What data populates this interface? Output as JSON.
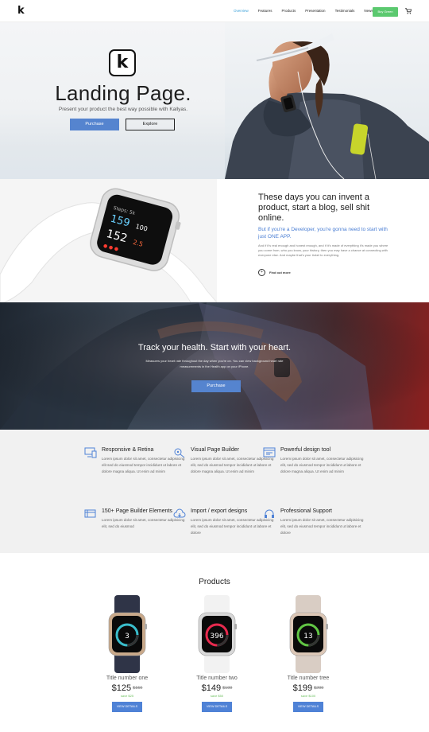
{
  "nav": {
    "logo": "k",
    "links": [
      "Overview",
      "Features",
      "Products",
      "Presentation",
      "Testimonials",
      "News"
    ],
    "cta": "Buy Green"
  },
  "hero": {
    "logo_letter": "k",
    "title": "Landing Page.",
    "subtitle": "Present your product the best way possible with Kallyas.",
    "btn_primary": "Purchase",
    "btn_secondary": "Explore"
  },
  "feature": {
    "heading": "These days you can invent a product, start a blog, sell shit online.",
    "lead": "But if you're a Developer, you're gonna need to start with just ONE APP.",
    "body": "And if it's real enough and honest enough, and if it's made of everything it's made you where you come from, who you know, your history, then you may have a chance at connecting with everyone else. And maybe that's your ticket to everything.",
    "link": "Find out more"
  },
  "health": {
    "title": "Track your health. Start with your heart.",
    "text": "Measures your heart rate throughout the day when you're on. You can view background heart rate measurements in the Health app on your iPhone.",
    "button": "Purchase"
  },
  "features_grid": [
    {
      "title": "Responsive & Retina",
      "text": "Lorem ipsum dolor sit amet, consectetur adipisicing elit sed do eiusmod tempor incididunt ut labore et dolore magna aliqua. Ut enim ad minim",
      "icon": "devices-icon"
    },
    {
      "title": "Visual Page Builder",
      "text": "Lorem ipsum dolor sit amet, consectetur adipisicing elit, sed do eiusmod tempor incididunt ut labore et dolore magna aliqua. Ut enim ad minim",
      "icon": "builder-icon"
    },
    {
      "title": "Powerful design tool",
      "text": "Lorem ipsum dolor sit amet, consectetur adipisicing elit, sed do eiusmod tempor incididunt ut labore et dolore magna aliqua. Ut enim ad minim",
      "icon": "design-tool-icon"
    },
    {
      "title": "150+ Page Builder Elements",
      "text": "Lorem ipsum dolor sit amet, consectetur adipisicing elit, sed do eiusmod",
      "icon": "elements-icon"
    },
    {
      "title": "Import / export designs",
      "text": "Lorem ipsum dolor sit amet, consectetur adipisicing elit, sed do eiusmod tempor incididunt ut labore et dolore",
      "icon": "cloud-sync-icon"
    },
    {
      "title": "Professional Support",
      "text": "Lorem ipsum dolor sit amet, consectetur adipisicing elit, sed do eiusmod tempor incididunt ut labore et dolore",
      "icon": "headset-icon"
    }
  ],
  "products": {
    "title": "Products",
    "items": [
      {
        "name": "Title number one",
        "price": "$125",
        "old": "$150",
        "save": "save $25",
        "button": "VIEW DETAILS",
        "band": "#2f3447",
        "case": "#c9a98a",
        "screen_num": "3",
        "ring": "#3fd0e0"
      },
      {
        "name": "Title number two",
        "price": "$149",
        "old": "$199",
        "save": "save $50",
        "button": "VIEW DETAILS",
        "band": "#f2f2f2",
        "case": "#d8d8d8",
        "screen_num": "396",
        "ring": "#ff2d55"
      },
      {
        "name": "Title number tree",
        "price": "$199",
        "old": "$299",
        "save": "save $100",
        "button": "VIEW DETAILS",
        "band": "#d9cdc4",
        "case": "#dcc7b6",
        "screen_num": "13",
        "ring": "#6ad94a"
      }
    ]
  }
}
